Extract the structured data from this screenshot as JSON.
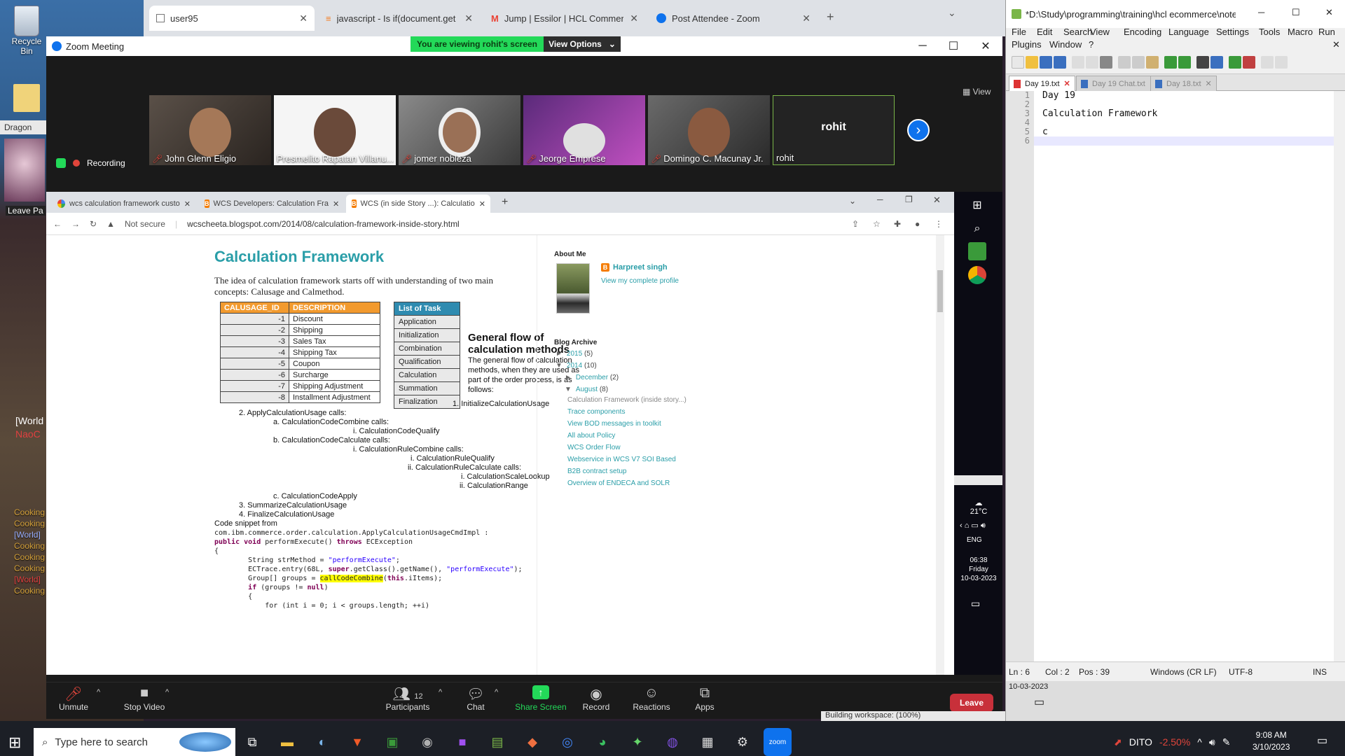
{
  "desktop": {
    "recycle_bin": "Recycle Bin",
    "dragon": "Dragon",
    "leave_party": "Leave Pa",
    "world_chat": "[World",
    "nao": "NaoC",
    "chat_lines": [
      "Cooking",
      "Cooking",
      "[World]",
      "Cooking",
      "Cooking",
      "Cooking",
      "[World]",
      "Cooking"
    ]
  },
  "bg_browser": {
    "tabs": [
      {
        "label": "user95"
      },
      {
        "label": "javascript - Is if(document.getEle"
      },
      {
        "label": "Jump | Essilor | HCL Commerce |"
      },
      {
        "label": "Post Attendee - Zoom"
      }
    ]
  },
  "zoom": {
    "title": "Zoom Meeting",
    "banner": "You are viewing rohit's screen",
    "view_options": "View Options",
    "view": "View",
    "recording": "Recording",
    "participants": [
      {
        "name": "John Glenn Eligio"
      },
      {
        "name": "Presmelito Rapatan Villanu..."
      },
      {
        "name": "jomer nobleza"
      },
      {
        "name": "Jeorge Emprese"
      },
      {
        "name": "Domingo C. Macunay Jr."
      },
      {
        "name": "rohit"
      }
    ],
    "rohit_big": "rohit",
    "toolbar": {
      "unmute": "Unmute",
      "stop_video": "Stop Video",
      "participants": "Participants",
      "participants_count": "12",
      "chat": "Chat",
      "share_screen": "Share Screen",
      "record": "Record",
      "reactions": "Reactions",
      "apps": "Apps",
      "leave": "Leave"
    }
  },
  "shared_chrome": {
    "tabs": [
      {
        "label": "wcs calculation framework custo"
      },
      {
        "label": "WCS Developers: Calculation Fra"
      },
      {
        "label": "WCS (in side Story ...): Calculatio"
      }
    ],
    "not_secure": "Not secure",
    "url": "wcscheeta.blogspot.com/2014/08/calculation-framework-inside-story.html"
  },
  "blog": {
    "title": "Calculation Framework",
    "intro": "The idea of calculation framework starts off with understanding of two main concepts: Calusage and Calmethod.",
    "calusage_table": {
      "headers": [
        "CALUSAGE_ID",
        "DESCRIPTION"
      ],
      "rows": [
        [
          "-1",
          "Discount"
        ],
        [
          "-2",
          "Shipping"
        ],
        [
          "-3",
          "Sales Tax"
        ],
        [
          "-4",
          "Shipping Tax"
        ],
        [
          "-5",
          "Coupon"
        ],
        [
          "-6",
          "Surcharge"
        ],
        [
          "-7",
          "Shipping Adjustment"
        ],
        [
          "-8",
          "Installment Adjustment"
        ]
      ]
    },
    "task_table": {
      "header": "List of Task",
      "rows": [
        "Application",
        "Initialization",
        "Combination",
        "Qualification",
        "Calculation",
        "Summation",
        "Finalization"
      ]
    },
    "general_flow_title": "General flow of calculation methods",
    "general_flow_desc": "The general flow of calculation methods, when they are used as part of the order process, is as follows:",
    "flow": [
      "1.  InitializeCalculationUsage",
      "2.  ApplyCalculationUsage calls:",
      "a.  CalculationCodeCombine calls:",
      "i.    CalculationCodeQualify",
      "b.  CalculationCodeCalculate calls:",
      "i.    CalculationRuleCombine calls:",
      "i.    CalculationRuleQualify",
      "ii.   CalculationRuleCalculate calls:",
      "i.    CalculationScaleLookup",
      "ii.   CalculationRange",
      "c.  CalculationCodeApply",
      "3.  SummarizeCalculationUsage",
      "4.  FinalizeCalculationUsage"
    ],
    "snippet_title": "Code snippet from",
    "code": {
      "l1": "com.ibm.commerce.order.calculation.ApplyCalculationUsageCmdImpl :",
      "l2a": "public void",
      "l2b": " performExecute() ",
      "l2c": "throws",
      "l2d": " ECException",
      "l3": "{",
      "l4a": "        String strMethod = ",
      "l4b": "\"performExecute\"",
      "l4c": ";",
      "l5a": "        ECTrace.entry(68L, ",
      "l5b": "super",
      "l5c": ".getClass().getName(), ",
      "l5d": "\"performExecute\"",
      "l5e": ");",
      "l6a": "        Group[] groups = ",
      "l6b": "callCodeCombine",
      "l6c": "(",
      "l6d": "this",
      "l6e": ".iItems);",
      "l7a": "        ",
      "l7b": "if",
      "l7c": " (groups != ",
      "l7d": "null",
      "l7e": ")",
      "l8": "        {",
      "l9": "            for (int i = 0; i < groups.length; ++i)"
    },
    "about_me": "About Me",
    "author": "Harpreet singh",
    "profile_link": "View my complete profile",
    "blog_archive": "Blog Archive",
    "archive": [
      {
        "label": "2015",
        "count": "(5)",
        "tri": "►"
      },
      {
        "label": "2014",
        "count": "(10)",
        "tri": "▼"
      },
      {
        "label": "December",
        "count": "(2)",
        "tri": "►"
      },
      {
        "label": "August",
        "count": "(8)",
        "tri": "▼"
      }
    ],
    "posts": [
      "Calculation Framework (inside story...)",
      "Trace components",
      "View BOD messages in toolkit",
      "All about Policy",
      "WCS Order Flow",
      "Webservice in WCS V7 SOI Based",
      "B2B contract setup",
      "Overview of ENDECA and SOLR"
    ]
  },
  "shared_taskbar": {
    "temp": "21°C",
    "lang": "ENG",
    "time": "06:38",
    "day": "Friday",
    "date": "10-03-2023"
  },
  "npp": {
    "title": "*D:\\Study\\programming\\training\\hcl ecommerce\\notes\\...",
    "menu1": [
      "File",
      "Edit",
      "Search",
      "View",
      "Encoding",
      "Language",
      "Settings",
      "Tools",
      "Macro",
      "Run"
    ],
    "menu2": [
      "Plugins",
      "Window",
      "?"
    ],
    "tabs": [
      "Day 19.txt",
      "Day 19 Chat.txt",
      "Day 18.txt"
    ],
    "lines": [
      "1",
      "2",
      "3",
      "4",
      "5",
      "6"
    ],
    "content": "Day 19\n\nCalculation Framework\n\nc",
    "status": {
      "ln": "Ln : 6",
      "col": "Col : 2",
      "pos": "Pos : 39",
      "eol": "Windows (CR LF)",
      "enc": "UTF-8",
      "ins": "INS"
    },
    "below_date": "10-03-2023",
    "below_text": "Building workspace: (100%)"
  },
  "taskbar": {
    "search_placeholder": "Type here to search",
    "network": "DITO",
    "stock": "-2.50%",
    "time": "9:08 AM",
    "date": "3/10/2023"
  },
  "colors": {
    "zoom_green": "#23d959",
    "blog_teal": "#2a9ea8",
    "orange_header": "#f29a2e",
    "leave_red": "#c8303a"
  }
}
